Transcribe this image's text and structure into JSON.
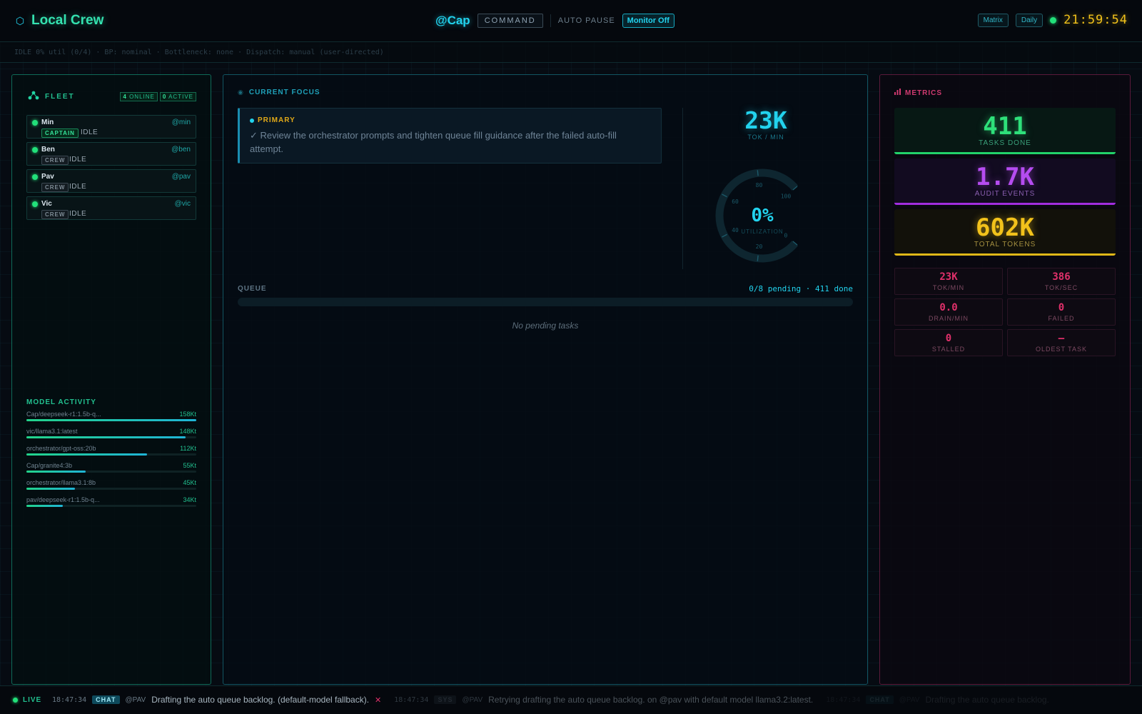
{
  "header": {
    "app_name": "Local Crew",
    "active_target": "@Cap",
    "command_label": "COMMAND",
    "auto_pause_label": "AUTO PAUSE",
    "monitor_label": "Monitor Off",
    "view_buttons": [
      "Matrix",
      "Daily"
    ],
    "clock": "21:59:54"
  },
  "status_line": "IDLE 0% util (0/4) · BP: nominal · Bottleneck: none · Dispatch: manual (user-directed)",
  "fleet": {
    "title": "FLEET",
    "online_count": "4",
    "online_label": "ONLINE",
    "active_count": "0",
    "active_label": "ACTIVE",
    "members": [
      {
        "name": "Min",
        "handle": "@min",
        "role": "CAPTAIN",
        "status": "IDLE"
      },
      {
        "name": "Ben",
        "handle": "@ben",
        "role": "CREW",
        "status": "IDLE"
      },
      {
        "name": "Pav",
        "handle": "@pav",
        "role": "CREW",
        "status": "IDLE"
      },
      {
        "name": "Vic",
        "handle": "@vic",
        "role": "CREW",
        "status": "IDLE"
      }
    ],
    "model_activity_title": "MODEL ACTIVITY",
    "model_activity": [
      {
        "model": "Cap/deepseek-r1:1.5b-q...",
        "value": "158Kt",
        "tokens_k": 158
      },
      {
        "model": "vic/llama3.1:latest",
        "value": "148Kt",
        "tokens_k": 148
      },
      {
        "model": "orchestrator/gpt-oss:20b",
        "value": "112Kt",
        "tokens_k": 112
      },
      {
        "model": "Cap/granite4:3b",
        "value": "55Kt",
        "tokens_k": 55
      },
      {
        "model": "orchestrator/llama3.1:8b",
        "value": "45Kt",
        "tokens_k": 45
      },
      {
        "model": "pav/deepseek-r1:1.5b-q...",
        "value": "34Kt",
        "tokens_k": 34
      }
    ]
  },
  "focus": {
    "title": "CURRENT FOCUS",
    "primary_label": "PRIMARY",
    "primary_text": "✓ Review the orchestrator prompts and tighten queue fill guidance after the failed auto-fill attempt.",
    "tok_rate": "23K",
    "tok_rate_label": "TOK / MIN",
    "gauge": {
      "value_text": "0%",
      "label": "UTILIZATION",
      "value_fraction": 0,
      "ticks": [
        "0",
        "20",
        "40",
        "60",
        "80",
        "100"
      ]
    },
    "queue_label": "QUEUE",
    "queue_summary": "0/8 pending · 411 done",
    "queue_empty": "No pending tasks"
  },
  "metrics": {
    "title": "METRICS",
    "big": [
      {
        "value": "411",
        "label": "TASKS DONE"
      },
      {
        "value": "1.7K",
        "label": "AUDIT EVENTS"
      },
      {
        "value": "602K",
        "label": "TOTAL TOKENS"
      }
    ],
    "small": [
      {
        "value": "23K",
        "label": "TOK/MIN"
      },
      {
        "value": "386",
        "label": "TOK/SEC"
      },
      {
        "value": "0.0",
        "label": "DRAIN/MIN"
      },
      {
        "value": "0",
        "label": "FAILED"
      },
      {
        "value": "0",
        "label": "STALLED"
      },
      {
        "value": "—",
        "label": "OLDEST TASK"
      }
    ]
  },
  "ticker": {
    "live_label": "LIVE",
    "items": [
      {
        "time": "18:47:34",
        "tag": "CHAT",
        "who": "@PAV",
        "message": "Drafting the auto queue backlog. (default-model fallback)."
      },
      {
        "time": "18:47:34",
        "tag": "SYS",
        "who": "@PAV",
        "message": "Retrying drafting the auto queue backlog. on @pav with default model llama3.2:latest."
      },
      {
        "time": "18:47:34",
        "tag": "CHAT",
        "who": "@PAV",
        "message": "Drafting the auto queue backlog."
      }
    ]
  },
  "icons": {
    "brand": "hexagon-icon",
    "fleet": "network-icon",
    "focus": "target-icon",
    "metrics": "bar-chart-icon"
  },
  "colors": {
    "accent": "#22d3ee",
    "brand": "#34e2b0",
    "online": "#22e07a",
    "clock": "#f2c21b",
    "tasks_done": "#2ee07a",
    "audit_events": "#b54cf0",
    "total_tokens": "#f2c21b",
    "metrics_small": "#e0306a"
  }
}
